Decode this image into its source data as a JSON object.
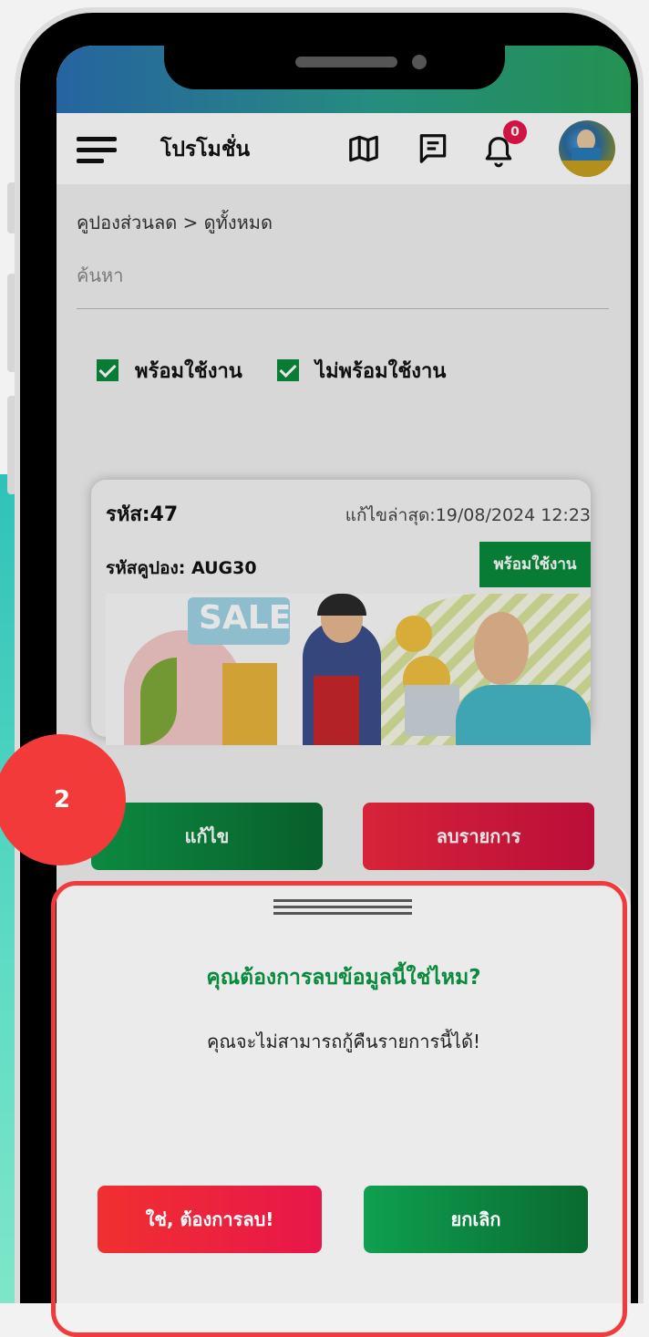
{
  "app": {
    "title": "โปรโมชั่น",
    "notification_count": "0",
    "icons": [
      "hamburger-menu-icon",
      "map-icon",
      "message-icon",
      "bell-icon"
    ]
  },
  "page": {
    "breadcrumb": "คูปองส่วนลด > ดูทั้งหมด",
    "search_placeholder": "ค้นหา"
  },
  "filters": [
    {
      "label": "พร้อมใช้งาน",
      "checked": true
    },
    {
      "label": "ไม่พร้อมใช้งาน",
      "checked": true
    }
  ],
  "coupon": {
    "code_label": "รหัส:47",
    "last_edited": "แก้ไขล่าสุด:19/08/2024 12:23",
    "coupon_code": "รหัสคูปอง: AUG30",
    "status": "พร้อมใช้งาน",
    "banner_text": "SALE"
  },
  "actions": {
    "edit": "แก้ไข",
    "delete": "ลบรายการ"
  },
  "dialog": {
    "question": "คุณต้องการลบข้อมูลนี้ใช่ไหม?",
    "message": "คุณจะไม่สามารถกู้คืนรายการนี้ได้!",
    "confirm": "ใช่, ต้องการลบ!",
    "cancel": "ยกเลิก"
  },
  "step_marker": "2",
  "colors": {
    "primary_green": "#0a8a3c",
    "danger_red": "#e8164a",
    "highlight_red": "#f23a3a"
  }
}
